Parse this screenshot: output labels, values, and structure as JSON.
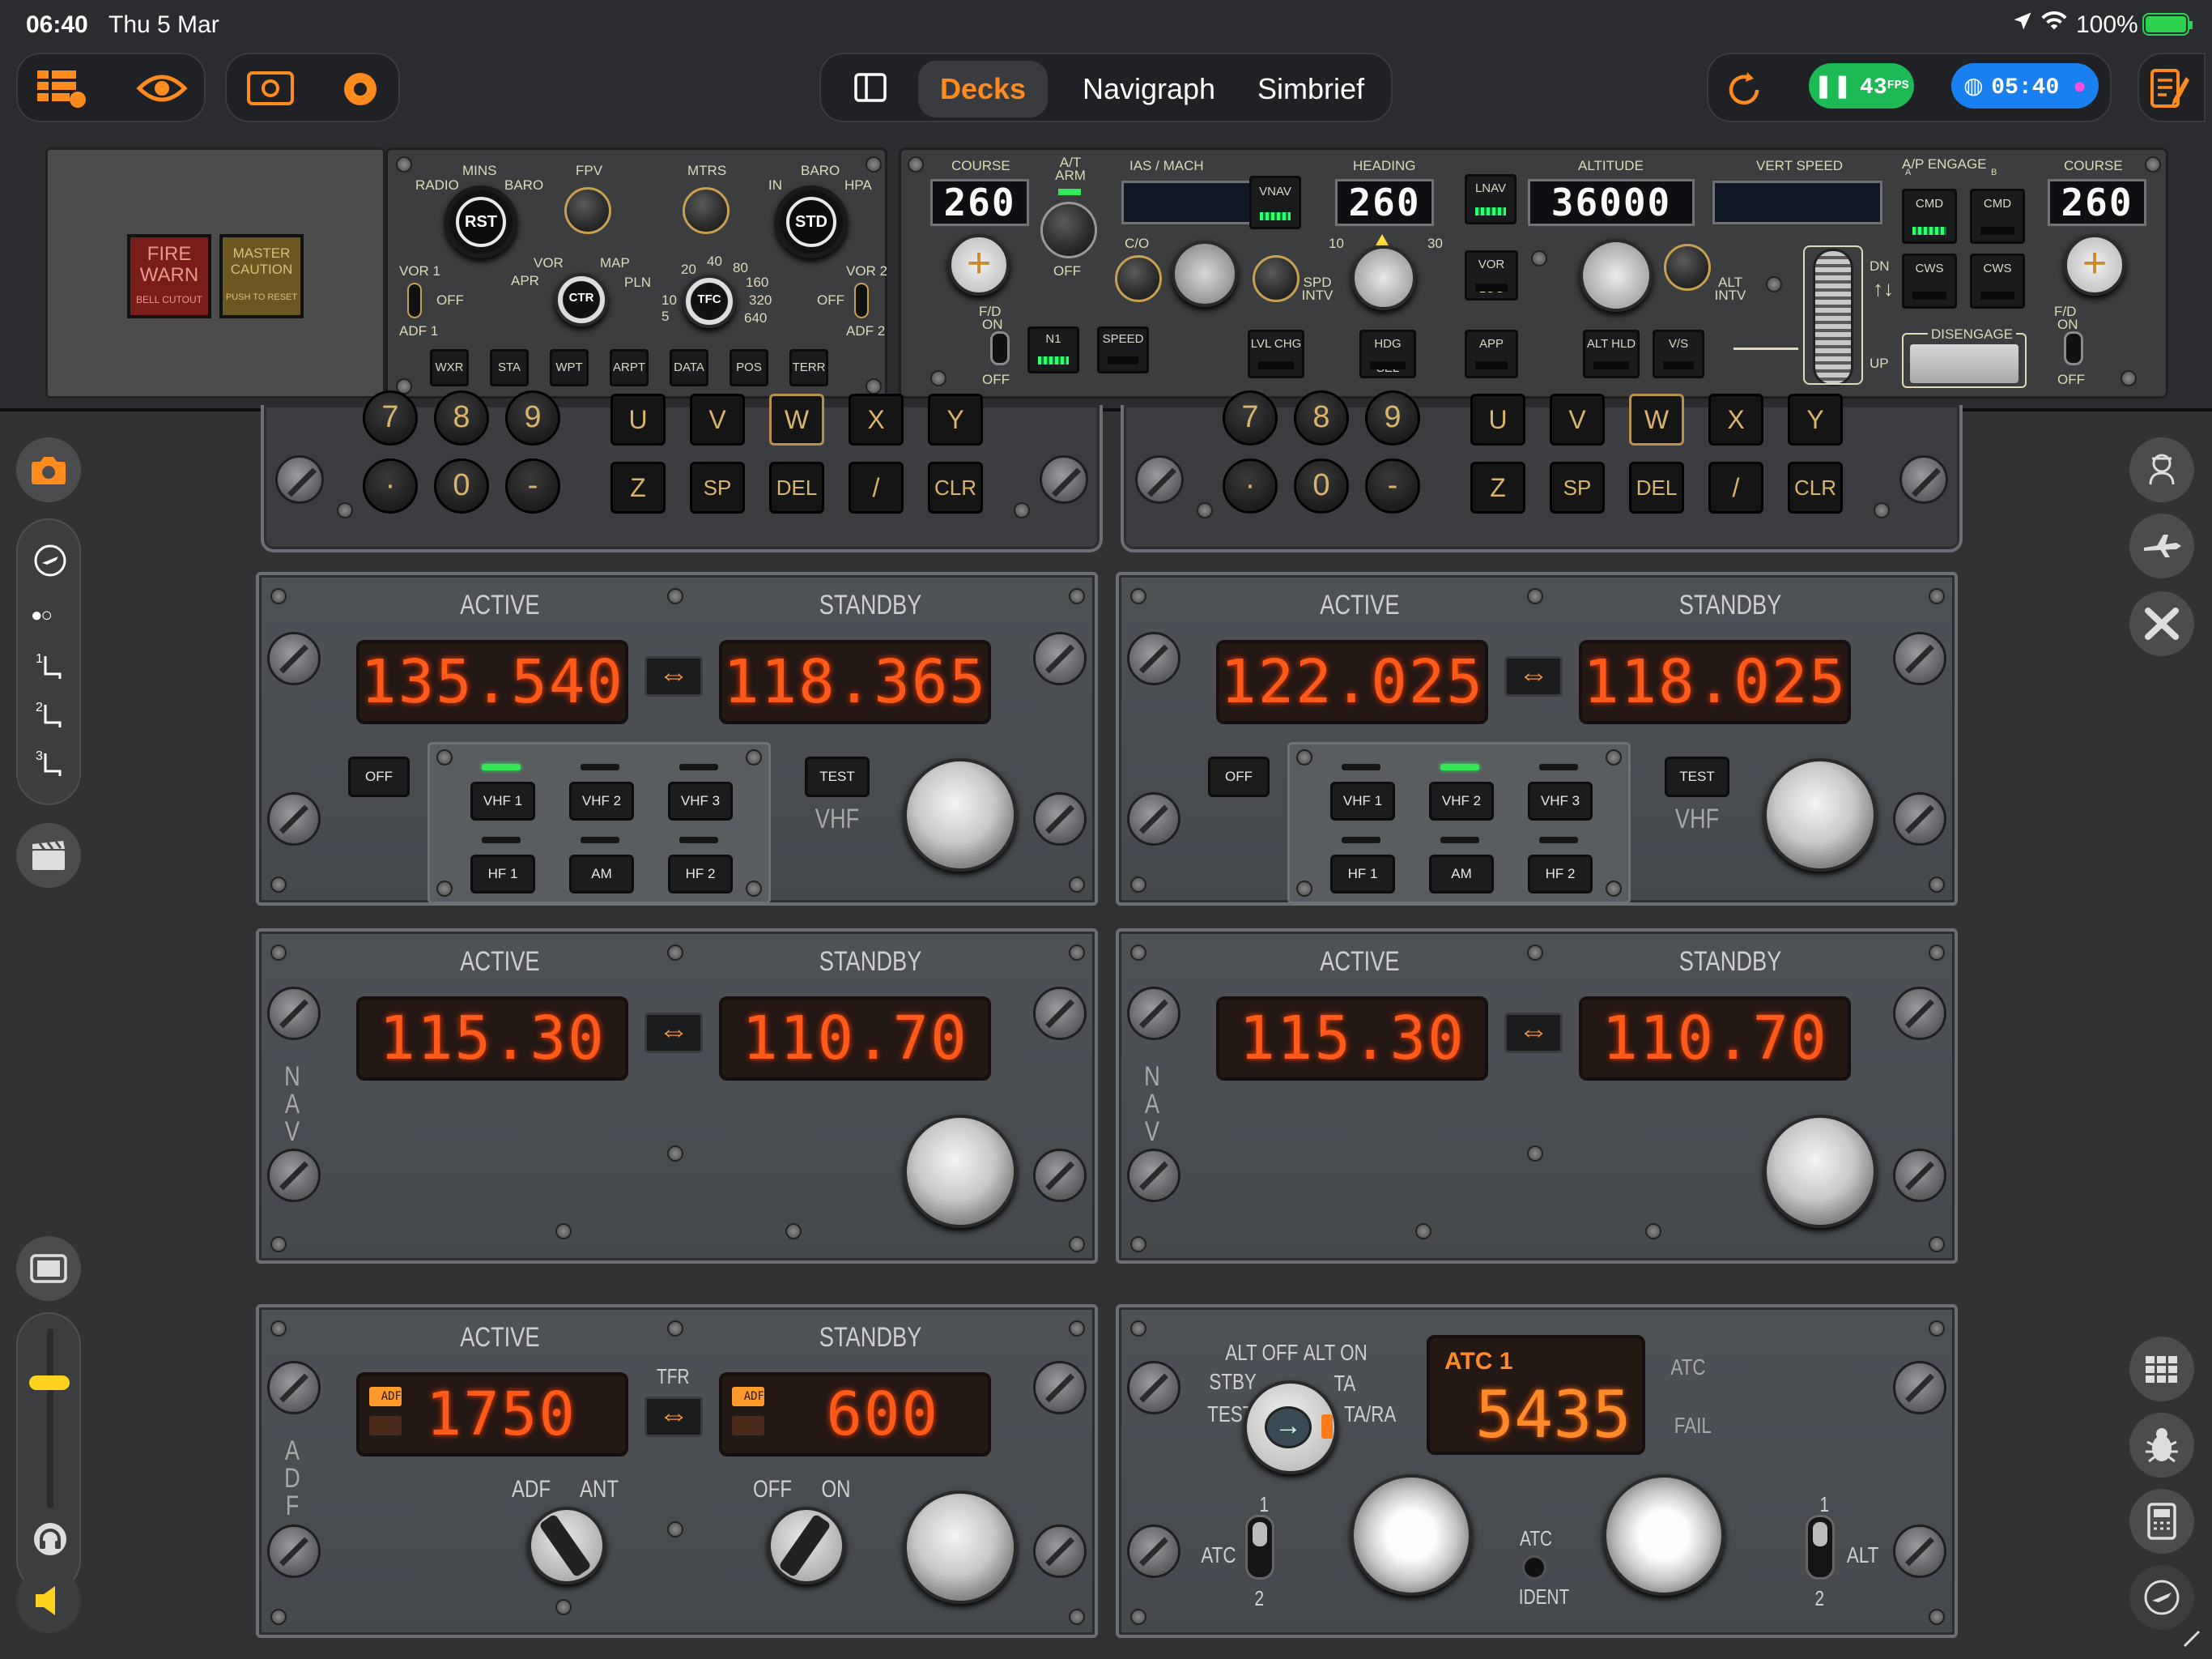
{
  "status": {
    "time": "06:40",
    "date": "Thu 5 Mar",
    "battery": "100%"
  },
  "nav": {
    "tabs": [
      "Decks",
      "Navigraph",
      "Simbrief"
    ],
    "active_tab": "Decks"
  },
  "fps": {
    "value": "43",
    "unit": "FPS"
  },
  "sim_time": "05:40",
  "colors": {
    "accent": "#ff8a1e",
    "fps_green": "#1db954",
    "time_blue": "#1a7ff0",
    "display_orange": "#ff5a1a"
  },
  "warn": {
    "fire_line1": "FIRE",
    "fire_line2": "WARN",
    "fire_sub": "BELL CUTOUT",
    "mc_line1": "MASTER",
    "mc_line2": "CAUTION",
    "mc_sub": "PUSH TO RESET"
  },
  "efis": {
    "radio": "RADIO",
    "mins": "MINS",
    "baro": "BARO",
    "rst": "RST",
    "fpv": "FPV",
    "mtrs": "MTRS",
    "in": "IN",
    "hpa": "HPA",
    "std": "STD",
    "vor1": "VOR 1",
    "adf1": "ADF 1",
    "off": "OFF",
    "vor": "VOR",
    "map": "MAP",
    "apr": "APR",
    "pln": "PLN",
    "ctr": "CTR",
    "ranges": [
      "5",
      "10",
      "20",
      "40",
      "80",
      "160",
      "320",
      "640"
    ],
    "tfc": "TFC",
    "vor2": "VOR 2",
    "adf2": "ADF 2",
    "buttons": [
      "WXR",
      "STA",
      "WPT",
      "ARPT",
      "DATA",
      "POS",
      "TERR"
    ]
  },
  "mcp": {
    "course_label": "COURSE",
    "course_left": "260",
    "course_right": "260",
    "at_arm": "A/T ARM",
    "at_off": "OFF",
    "fd": "F/D",
    "fd_on": "ON",
    "fd_off": "OFF",
    "ias_mach": "IAS / MACH",
    "vnav": "VNAV",
    "co": "C/O",
    "spd_intv": "SPD INTV",
    "heading_label": "HEADING",
    "heading": "260",
    "hdg_10": "10",
    "hdg_30": "30",
    "lnav": "LNAV",
    "vor_loc": "VOR LOC",
    "app": "APP",
    "altitude_label": "ALTITUDE",
    "altitude": "36000",
    "alt_intv": "ALT INTV",
    "vert_speed": "VERT SPEED",
    "dn": "DN",
    "up": "UP",
    "ap_engage": "A/P ENGAGE",
    "a": "A",
    "b": "B",
    "cmd": "CMD",
    "cws": "CWS",
    "disengage": "DISENGAGE",
    "n1": "N1",
    "speed": "SPEED",
    "lvl_chg": "LVL CHG",
    "hdg_sel": "HDG SEL",
    "alt_hld": "ALT HLD",
    "vs": "V/S"
  },
  "cdu_keys": {
    "row1": [
      "7",
      "8",
      "9",
      "U",
      "V",
      "W",
      "X",
      "Y"
    ],
    "row2": [
      "·",
      "0",
      "-",
      "Z",
      "SP",
      "DEL",
      "/",
      "CLR"
    ]
  },
  "vhf1": {
    "active_label": "ACTIVE",
    "standby_label": "STANDBY",
    "active": "135.540",
    "standby": "118.365",
    "off": "OFF",
    "test": "TEST",
    "mode": "VHF",
    "btns": [
      "VHF 1",
      "VHF 2",
      "VHF 3",
      "HF 1",
      "AM",
      "HF 2"
    ],
    "selected": "VHF 1"
  },
  "vhf2": {
    "active_label": "ACTIVE",
    "standby_label": "STANDBY",
    "active": "122.025",
    "standby": "118.025",
    "off": "OFF",
    "test": "TEST",
    "mode": "VHF",
    "btns": [
      "VHF 1",
      "VHF 2",
      "VHF 3",
      "HF 1",
      "AM",
      "HF 2"
    ],
    "selected": "VHF 2"
  },
  "nav1": {
    "active_label": "ACTIVE",
    "standby_label": "STANDBY",
    "active": "115.30",
    "standby": "110.70",
    "side": "N A V"
  },
  "nav2": {
    "active_label": "ACTIVE",
    "standby_label": "STANDBY",
    "active": "115.30",
    "standby": "110.70",
    "side": "N A V"
  },
  "adf": {
    "active_label": "ACTIVE",
    "standby_label": "STANDBY",
    "active": "1750",
    "standby": "600",
    "tfr": "TFR",
    "tag": "ADF",
    "adf": "ADF",
    "ant": "ANT",
    "off": "OFF",
    "on": "ON",
    "side": "A D F"
  },
  "xpdr": {
    "alt_off": "ALT OFF",
    "alt_on": "ALT ON",
    "stby": "STBY",
    "ta": "TA",
    "test": "TEST",
    "tara": "TA/RA",
    "atc1": "ATC 1",
    "code": "5435",
    "atc": "ATC",
    "fail": "FAIL",
    "sw1_top": "1",
    "sw1_bot": "2",
    "atc_left": "ATC",
    "ident_atc": "ATC",
    "ident": "IDENT",
    "sw2_top": "1",
    "sw2_bot": "2",
    "alt": "ALT"
  },
  "side_left": {
    "seats": [
      "1",
      "2",
      "3"
    ]
  },
  "volume": {
    "level": 0.7
  }
}
